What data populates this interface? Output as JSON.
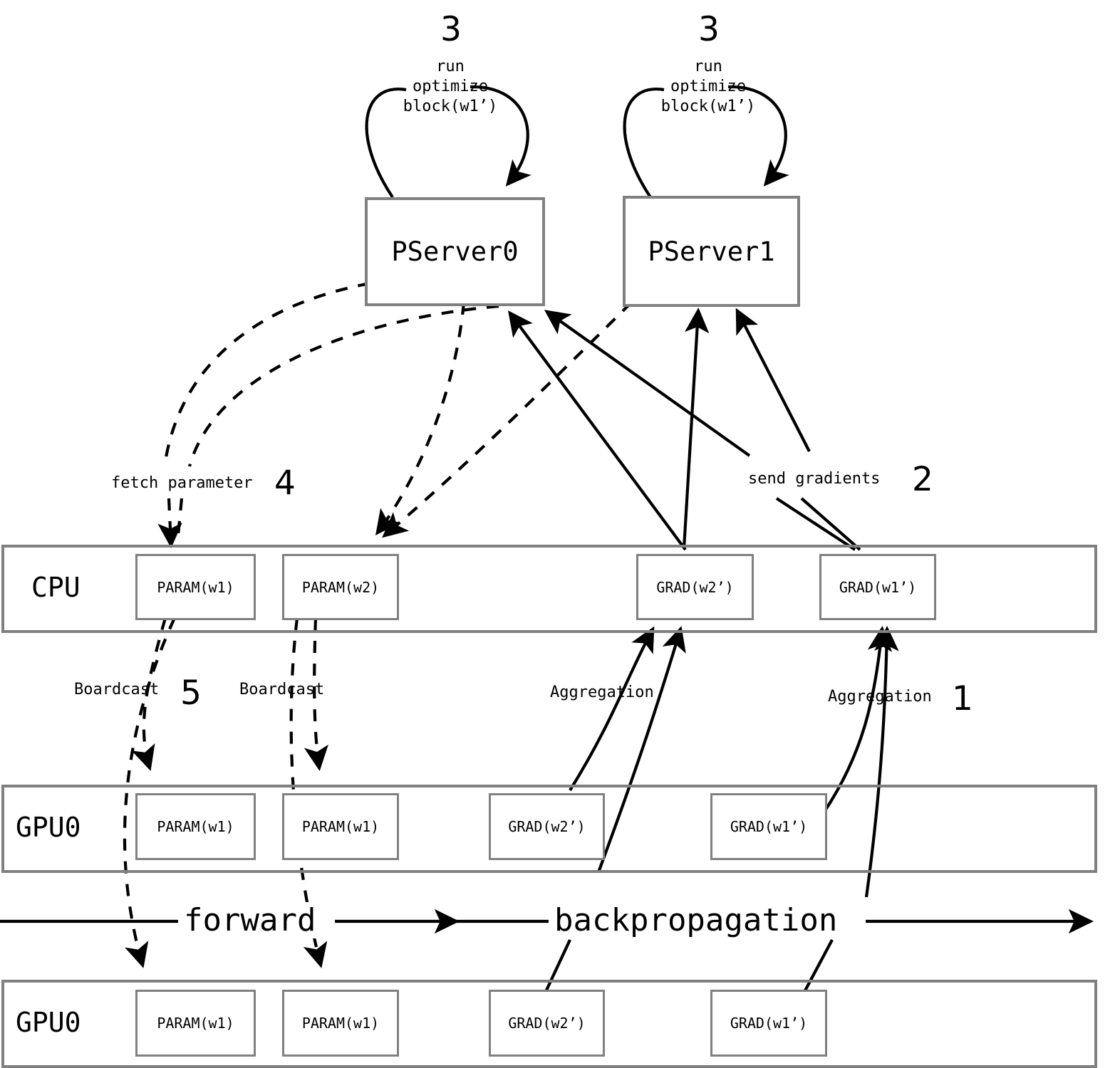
{
  "diagram": {
    "title": "Parameter server distributed training data flow",
    "colors": {
      "box_border": "#808080",
      "line": "#000000",
      "background": "#ffffff"
    }
  },
  "pservers": [
    {
      "name": "PServer0",
      "step_number": "3",
      "loop_label_line1": "run",
      "loop_label_line2": "optimize",
      "loop_label_line3": "block(w1’)"
    },
    {
      "name": "PServer1",
      "step_number": "3",
      "loop_label_line1": "run",
      "loop_label_line2": "optimize",
      "loop_label_line3": "block(w1’)"
    }
  ],
  "bands": [
    {
      "label": "CPU",
      "cells": [
        {
          "text": "PARAM(w1)"
        },
        {
          "text": "PARAM(w2)"
        },
        {
          "text": "GRAD(w2’)"
        },
        {
          "text": "GRAD(w1’)"
        }
      ]
    },
    {
      "label": "GPU0",
      "cells": [
        {
          "text": "PARAM(w1)"
        },
        {
          "text": "PARAM(w1)"
        },
        {
          "text": "GRAD(w2’)"
        },
        {
          "text": "GRAD(w1’)"
        }
      ]
    },
    {
      "label": "GPU0",
      "cells": [
        {
          "text": "PARAM(w1)"
        },
        {
          "text": "PARAM(w1)"
        },
        {
          "text": "GRAD(w2’)"
        },
        {
          "text": "GRAD(w1’)"
        }
      ]
    }
  ],
  "annotations": {
    "fetch_parameter": "fetch parameter",
    "fetch_parameter_step": "4",
    "send_gradients": "send gradients",
    "send_gradients_step": "2",
    "boardcast_left": "Boardcast",
    "boardcast_left_step": "5",
    "boardcast_right": "Boardcast",
    "aggregation_left": "Aggregation",
    "aggregation_right": "Aggregation",
    "aggregation_right_step": "1"
  },
  "flow": {
    "forward": "forward",
    "backpropagation": "backpropagation"
  }
}
